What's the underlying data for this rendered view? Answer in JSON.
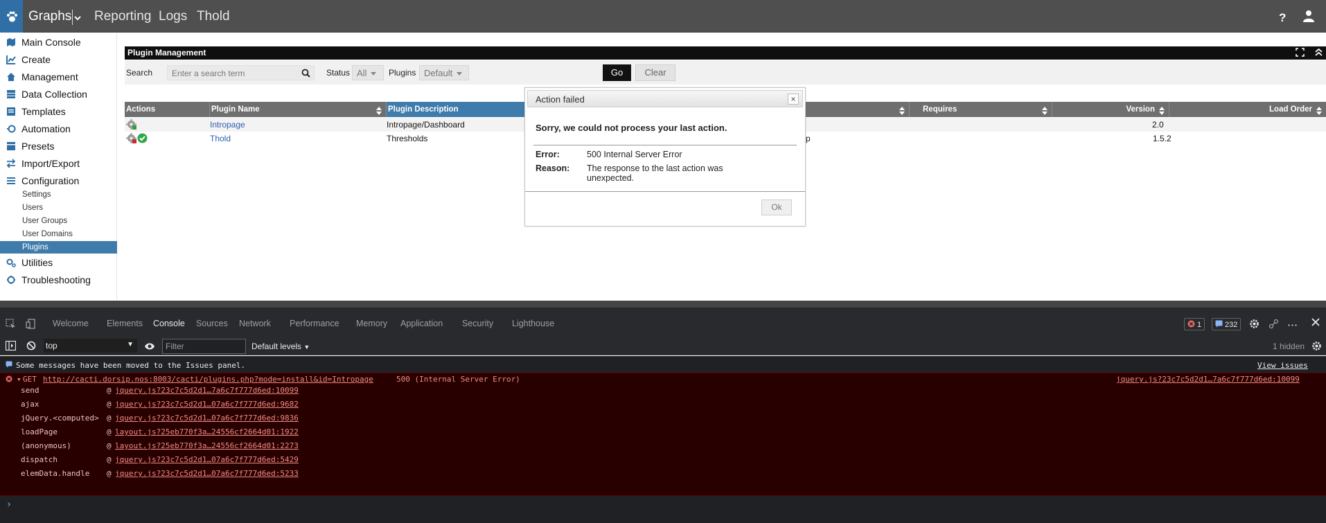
{
  "nav": {
    "tabs": [
      "Graphs",
      "Reporting",
      "Logs",
      "Thold"
    ],
    "help": "?"
  },
  "sidebar": {
    "items": [
      {
        "label": "Main Console",
        "icon": "map-icon"
      },
      {
        "label": "Create",
        "icon": "chart-icon"
      },
      {
        "label": "Management",
        "icon": "home-icon"
      },
      {
        "label": "Data Collection",
        "icon": "database-icon"
      },
      {
        "label": "Templates",
        "icon": "template-icon"
      },
      {
        "label": "Automation",
        "icon": "automation-icon"
      },
      {
        "label": "Presets",
        "icon": "presets-icon"
      },
      {
        "label": "Import/Export",
        "icon": "exchange-icon"
      },
      {
        "label": "Configuration",
        "icon": "sliders-icon"
      }
    ],
    "config_items": [
      "Settings",
      "Users",
      "User Groups",
      "User Domains",
      "Plugins"
    ],
    "bottom_items": [
      {
        "label": "Utilities",
        "icon": "cogs-icon"
      },
      {
        "label": "Troubleshooting",
        "icon": "wrench-icon"
      }
    ]
  },
  "plugins": {
    "title": "Plugin Management",
    "filter": {
      "search_label": "Search",
      "search_placeholder": "Enter a search term",
      "status_label": "Status",
      "status_value": "All",
      "plugins_label": "Plugins",
      "plugins_value": "Default",
      "go": "Go",
      "clear": "Clear"
    },
    "columns": [
      "Actions",
      "Plugin Name",
      "Plugin Description",
      "Requires",
      "Version",
      "Load Order"
    ],
    "rows": [
      {
        "name": "Intropage",
        "description": "Intropage/Dashboard",
        "requires": "",
        "version": "2.0"
      },
      {
        "name": "Thold",
        "description": "Thresholds",
        "requires": "p",
        "version": "1.5.2"
      }
    ]
  },
  "dialog": {
    "title": "Action failed",
    "close": "×",
    "message": "Sorry, we could not process your last action.",
    "error_label": "Error:",
    "error_value": "500 Internal Server Error",
    "reason_label": "Reason:",
    "reason_line1": "The response to the last action was",
    "reason_line2": "unexpected.",
    "ok": "Ok"
  },
  "devtools": {
    "tabs": [
      "Welcome",
      "Elements",
      "Console",
      "Sources",
      "Network",
      "Performance",
      "Memory",
      "Application",
      "Security",
      "Lighthouse"
    ],
    "error_count": "1",
    "issue_count": "232",
    "context": "top",
    "filter_placeholder": "Filter",
    "levels": "Default levels",
    "hidden": "1 hidden",
    "info_message": "Some messages have been moved to the Issues panel.",
    "view_issues": "View issues",
    "error_method": "GET",
    "error_url": "http://cacti.dorsip.nos:8003/cacti/plugins.php?mode=install&id=Intropage",
    "error_status": "500 (Internal Server Error)",
    "error_source": "jquery.js?23c7c5d2d1…7a6c7f777d6ed:10099",
    "stack": [
      {
        "fn": "send",
        "src": "jquery.js?23c7c5d2d1…7a6c7f777d6ed:10099"
      },
      {
        "fn": "ajax",
        "src": "jquery.js?23c7c5d2d1…07a6c7f777d6ed:9682"
      },
      {
        "fn": "jQuery.<computed>",
        "src": "jquery.js?23c7c5d2d1…07a6c7f777d6ed:9836"
      },
      {
        "fn": "loadPage",
        "src": "layout.js?25eb770f3a…24556cf2664d01:1922"
      },
      {
        "fn": "(anonymous)",
        "src": "layout.js?25eb770f3a…24556cf2664d01:2273"
      },
      {
        "fn": "dispatch",
        "src": "jquery.js?23c7c5d2d1…07a6c7f777d6ed:5429"
      },
      {
        "fn": "elemData.handle",
        "src": "jquery.js?23c7c5d2d1…07a6c7f777d6ed:5233"
      }
    ],
    "at_symbol": "@",
    "prompt": "›"
  }
}
